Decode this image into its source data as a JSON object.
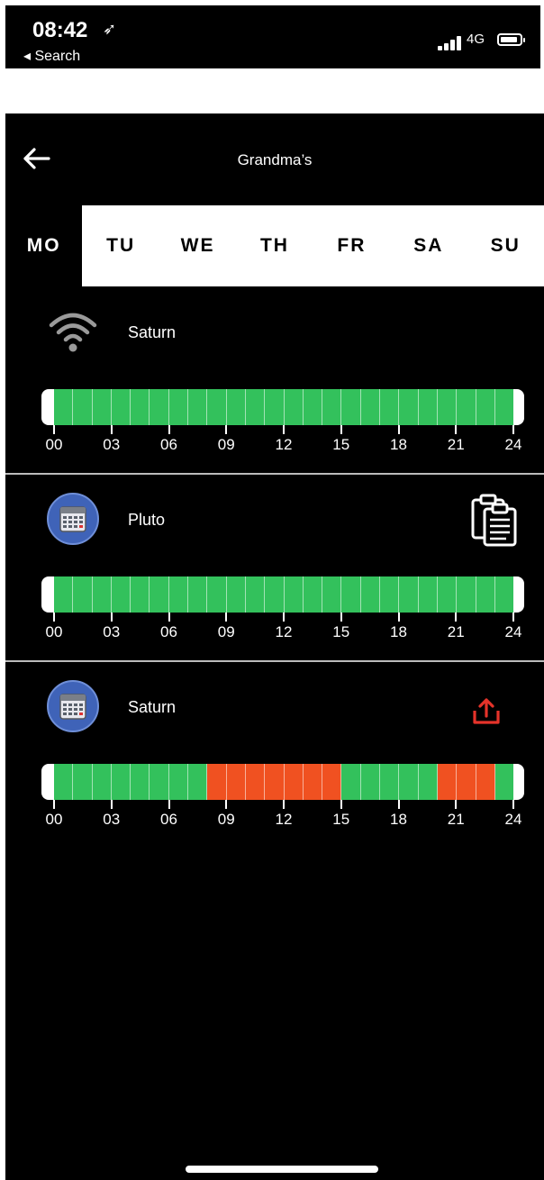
{
  "status_bar": {
    "time": "08:42",
    "location_glyph": "➶",
    "back_to_app": "◂ Search",
    "network": "4G"
  },
  "header": {
    "title": "Grandma’s",
    "back_icon": "arrow-left-icon"
  },
  "days": {
    "items": [
      "MO",
      "TU",
      "WE",
      "TH",
      "FR",
      "SA",
      "SU"
    ],
    "selected": "MO"
  },
  "devices": [
    {
      "name": "Saturn",
      "icon": "wifi-icon",
      "action_icon": null,
      "hours": [
        1,
        1,
        1,
        1,
        1,
        1,
        1,
        1,
        1,
        1,
        1,
        1,
        1,
        1,
        1,
        1,
        1,
        1,
        1,
        1,
        1,
        1,
        1,
        1
      ]
    },
    {
      "name": "Pluto",
      "icon": "calendar-icon",
      "action_icon": "clipboard-icon",
      "hours": [
        1,
        1,
        1,
        1,
        1,
        1,
        1,
        1,
        1,
        1,
        1,
        1,
        1,
        1,
        1,
        1,
        1,
        1,
        1,
        1,
        1,
        1,
        1,
        1
      ]
    },
    {
      "name": "Saturn",
      "icon": "calendar-icon",
      "action_icon": "share-upload-icon",
      "hours": [
        1,
        1,
        1,
        1,
        1,
        1,
        1,
        1,
        0,
        0,
        0,
        0,
        0,
        0,
        0,
        1,
        1,
        1,
        1,
        1,
        0,
        0,
        0,
        1
      ]
    }
  ],
  "timeline": {
    "tick_labels": [
      "00",
      "03",
      "06",
      "09",
      "12",
      "15",
      "18",
      "21",
      "24"
    ],
    "allowed_color": "#33c15c",
    "blocked_color": "#f05121",
    "share_icon_color": "#e5332a"
  }
}
